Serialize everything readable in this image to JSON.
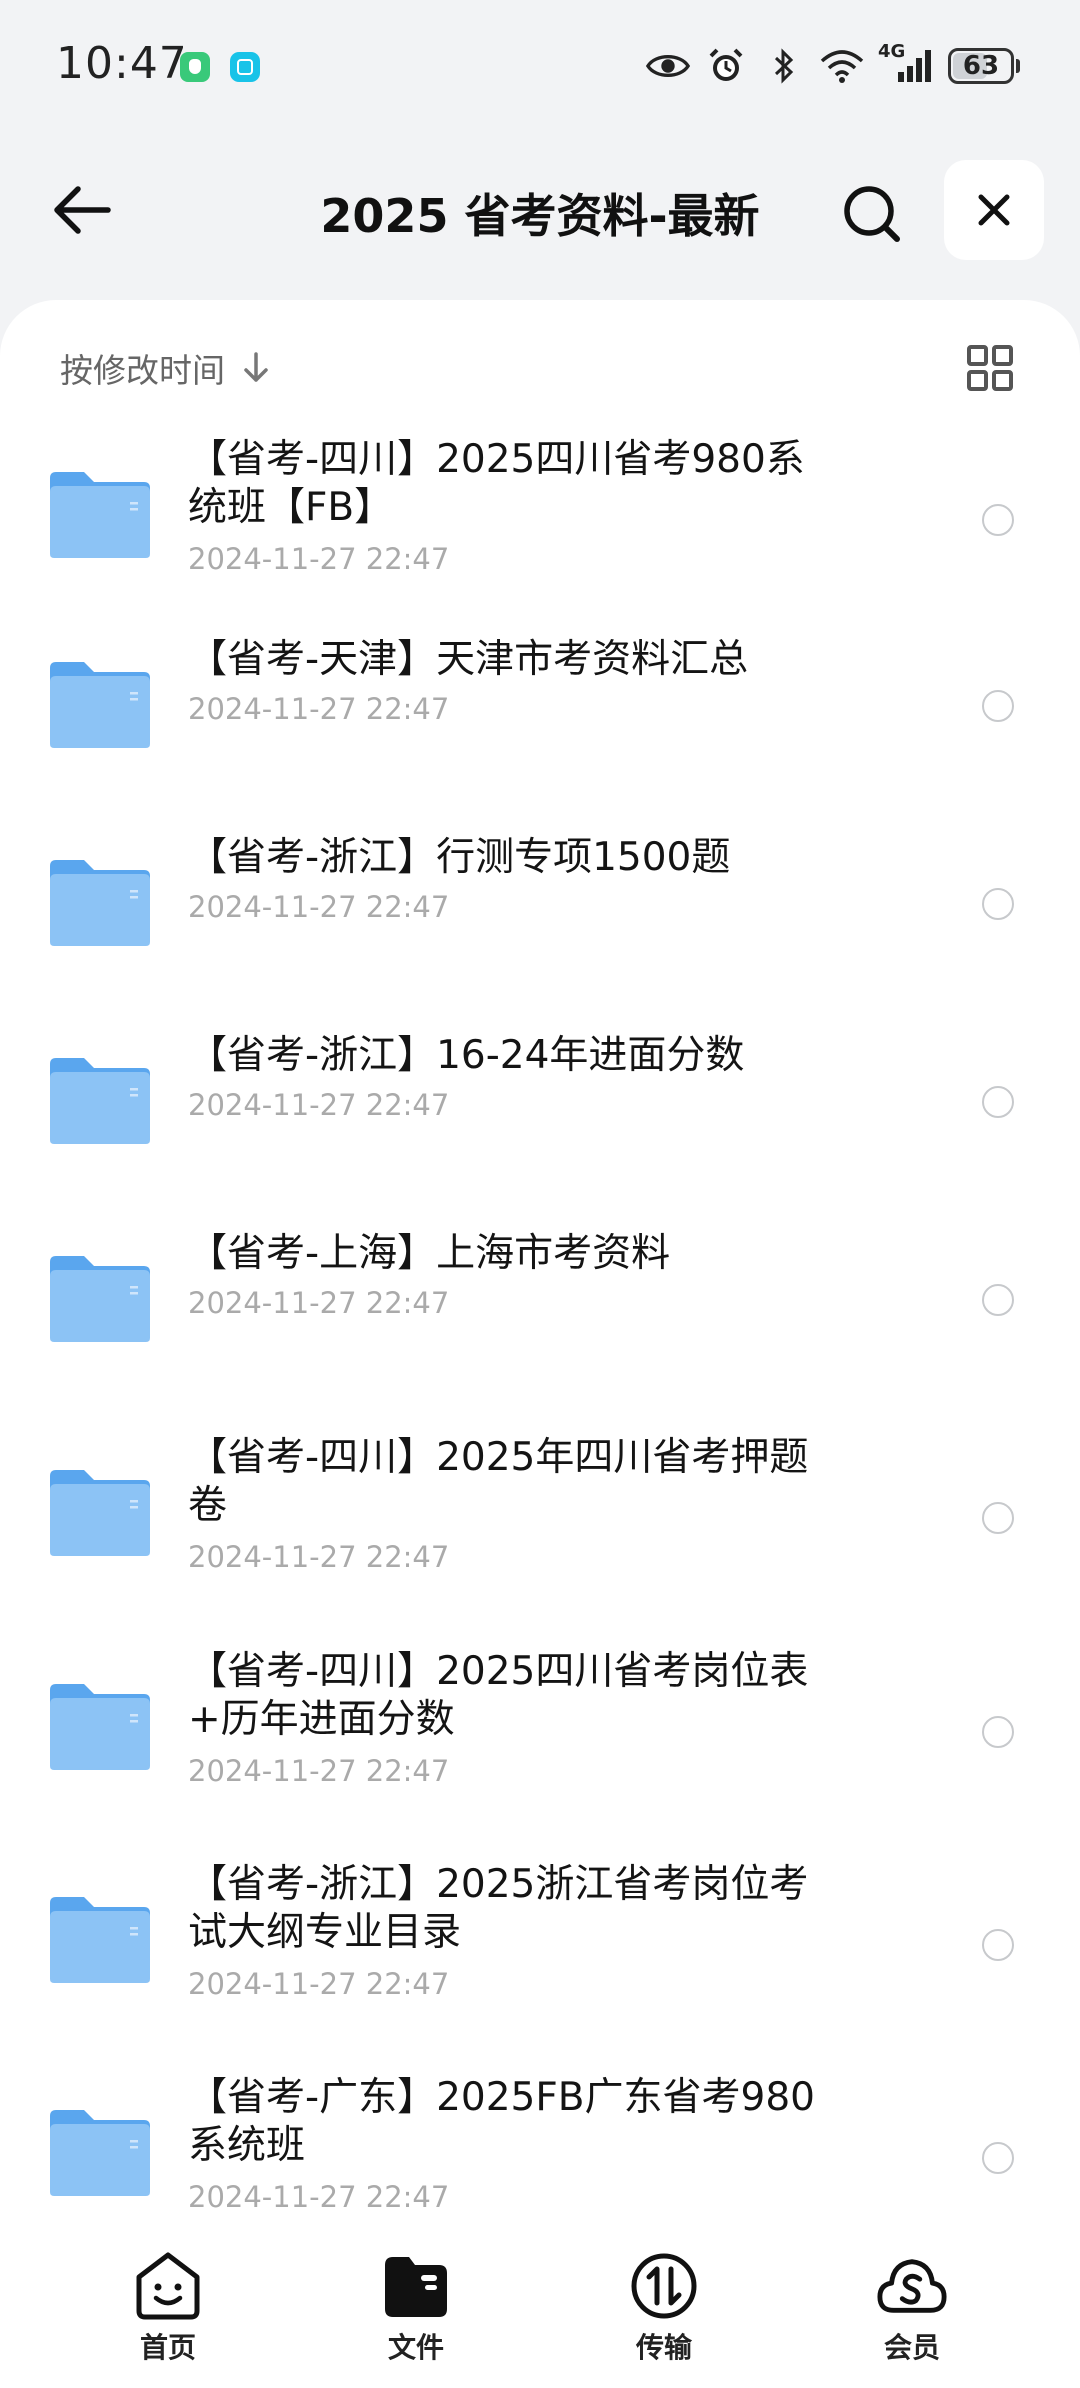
{
  "status_bar": {
    "time": "10:47",
    "network": "4G",
    "battery": "63",
    "battery_level": 0.63
  },
  "header": {
    "title": "2025 省考资料-最新",
    "back_icon": "arrow-left-icon",
    "search_icon": "search-icon",
    "close_icon": "close-icon"
  },
  "sort": {
    "label": "按修改时间",
    "direction_icon": "arrow-down-icon",
    "view_icon": "grid-view-icon"
  },
  "files": [
    {
      "title_lines": [
        "【省考-四川】2025四川省考980系",
        "统班【FB】"
      ],
      "date": "2024-11-27 22:47"
    },
    {
      "title_lines": [
        "【省考-天津】天津市考资料汇总"
      ],
      "date": "2024-11-27 22:47"
    },
    {
      "title_lines": [
        "【省考-浙江】行测专项1500题"
      ],
      "date": "2024-11-27 22:47"
    },
    {
      "title_lines": [
        "【省考-浙江】16-24年进面分数"
      ],
      "date": "2024-11-27 22:47"
    },
    {
      "title_lines": [
        "【省考-上海】上海市考资料"
      ],
      "date": "2024-11-27 22:47"
    },
    {
      "title_lines": [
        "【省考-四川】2025年四川省考押题",
        "卷"
      ],
      "date": "2024-11-27 22:47"
    },
    {
      "title_lines": [
        "【省考-四川】2025四川省考岗位表",
        "+历年进面分数"
      ],
      "date": "2024-11-27 22:47"
    },
    {
      "title_lines": [
        "【省考-浙江】2025浙江省考岗位考",
        "试大纲专业目录"
      ],
      "date": "2024-11-27 22:47"
    },
    {
      "title_lines": [
        "【省考-广东】2025FB广东省考980",
        "系统班"
      ],
      "date": "2024-11-27 22:47"
    }
  ],
  "nav": [
    {
      "label": "首页",
      "icon": "smiley-home-icon"
    },
    {
      "label": "文件",
      "icon": "folder-icon"
    },
    {
      "label": "传输",
      "icon": "transfer-icon"
    },
    {
      "label": "会员",
      "icon": "cloud-vip-icon"
    }
  ],
  "colors": {
    "folder_front": "#8cc3f5",
    "folder_back": "#5aa6ee",
    "background": "#f2f3f5"
  }
}
